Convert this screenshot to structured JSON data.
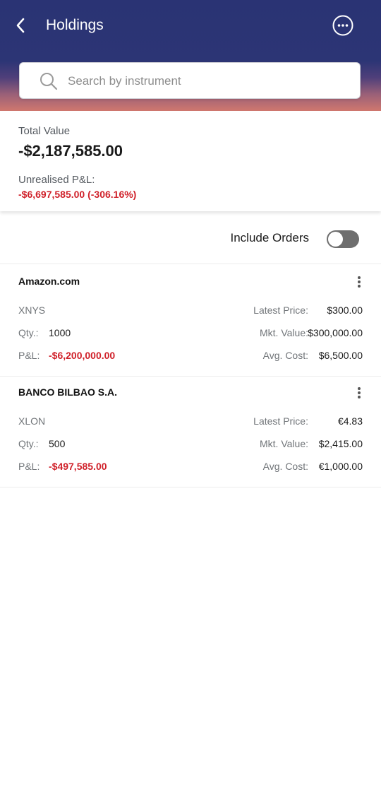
{
  "header": {
    "title": "Holdings",
    "back_icon": "chevron-left-icon",
    "more_icon": "more-horizontal-icon"
  },
  "search": {
    "placeholder": "Search by instrument",
    "value": ""
  },
  "summary": {
    "total_label": "Total Value",
    "total_value": "-$2,187,585.00",
    "pnl_label": "Unrealised P&L:",
    "pnl_value": "-$6,697,585.00 (-306.16%)"
  },
  "orders": {
    "label": "Include Orders",
    "enabled": false
  },
  "labels": {
    "qty": "Qty.:",
    "pnl": "P&L:",
    "latest_price": "Latest Price:",
    "mkt_value": "Mkt. Value:",
    "avg_cost": "Avg. Cost:"
  },
  "holdings": [
    {
      "name": "Amazon.com",
      "exchange": "XNYS",
      "qty": "1000",
      "pnl": "-$6,200,000.00",
      "latest_price": "$300.00",
      "mkt_value": "$300,000.00",
      "avg_cost": "$6,500.00"
    },
    {
      "name": "BANCO BILBAO S.A.",
      "exchange": "XLON",
      "qty": "500",
      "pnl": "-$497,585.00",
      "latest_price": "€4.83",
      "mkt_value": "$2,415.00",
      "avg_cost": "€1,000.00"
    }
  ],
  "colors": {
    "header_top": "#2a3374",
    "header_bottom": "#d0776e",
    "negative": "#d0212a",
    "toggle_off": "#6e6e6e"
  }
}
